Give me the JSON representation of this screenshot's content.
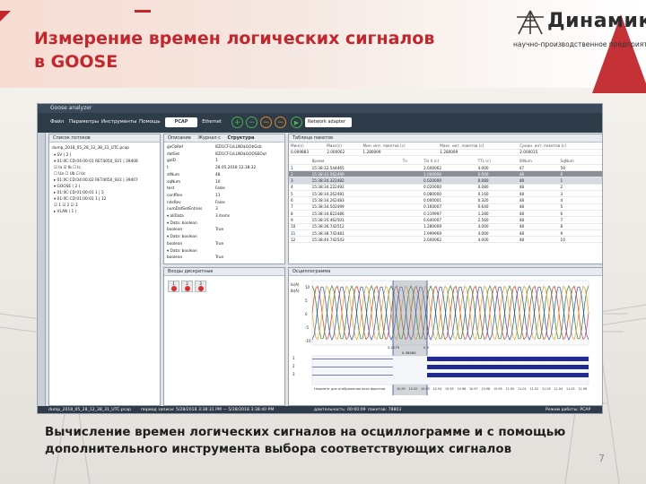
{
  "slide": {
    "title_line1": "Измерение времен логических сигналов",
    "title_line2": "в GOOSE",
    "caption_line1": "Вычисление времен логических сигналов на осциллограмме и с помощью",
    "caption_line2": "дополнительного инструмента выбора соответствующих сигналов",
    "page_number": "7",
    "accent_color": "#c1272d"
  },
  "logo": {
    "name": "Динамика",
    "tagline": "научно-производственное предприятие",
    "icon": "tower-logo-icon"
  },
  "app": {
    "window_title": "Goose analyzer",
    "menu": [
      "Файл",
      "Параметры",
      "Инструменты",
      "Помощь"
    ],
    "toolbar": {
      "pcap_label": "PCAP",
      "ethernet_label": "Ethernet",
      "adapter_label": "Network adapter",
      "icons": [
        "plus-icon",
        "minus-icon",
        "stop-icon",
        "clear-icon",
        "play-icon"
      ]
    },
    "stream_list": {
      "title": "Список потоков",
      "file": "dump_2018_05_28_12_38_31_UTC.pcap",
      "rows": [
        "▾ SV ( 2 )",
        "   ▾ 01:0C:CD:04:00:01   RET4050_SV1  |  39408",
        "      ☑ Ia    ☑ Ib    ☐ Ic",
        "      ☐ Ua    ☐ Ub    ☐ Uc",
        "   ▸ 01:0C:CD:04:00:02   RET4050_SV2  |  39407",
        "▾ GOOSE ( 2 )",
        "   ▸ 01:0C:CD:01:00:01   1  |  5",
        "   ▾ 01:0C:CD:01:00:01   1  |  12",
        "      ☑ 1   ☑ 2   ☑ 3",
        "▸ VLAN ( 1 )"
      ]
    },
    "description": {
      "tabs": [
        "Описание",
        "Журнал с",
        "Структура"
      ],
      "rows": [
        [
          "goCbRef",
          "IED1CFG/LLN0$GO$Gcb"
        ],
        [
          "datSet",
          "IED1CFG/LLN0$GOOSEOut"
        ],
        [
          "goID",
          "1"
        ],
        [
          "t",
          "28.05.2018 12:38:32"
        ],
        [
          "stNum",
          "48"
        ],
        [
          "sqNum",
          "10"
        ],
        [
          "test",
          "False"
        ],
        [
          "confRev",
          "11"
        ],
        [
          "ndsRev",
          "False"
        ],
        [
          "numDatSetEntries",
          "3"
        ],
        [
          "▾ allData",
          "3 items"
        ],
        [
          "   ▾ Data: boolean",
          ""
        ],
        [
          "        boolean",
          "True"
        ],
        [
          "   ▾ Data: boolean",
          ""
        ],
        [
          "        boolean",
          "True"
        ],
        [
          "   ▾ Data: boolean",
          ""
        ],
        [
          "        boolean",
          "True"
        ]
      ]
    },
    "discrete": {
      "title": "Входы дискретные",
      "indicators": [
        "1",
        "2",
        "3"
      ]
    },
    "packet_table": {
      "title": "Таблица пакетов",
      "summary_headers": [
        "Мин(с)",
        "Макс(с)",
        "Мин. инт. пакетов (с)",
        "Макс. инт. пакетов (с)",
        "Средн. инт. пакетов (с)"
      ],
      "summary_values": [
        "0.009883",
        "2.000062",
        "1.280009",
        "1.280009",
        "2.000015"
      ],
      "headers": [
        "",
        "Время",
        "Tn",
        "Tin ñ (c)",
        "TTL (c)",
        "StNum",
        "SqNum"
      ],
      "rows": [
        [
          "1",
          "15:38:32.544465",
          "2.000062",
          "4.000",
          "47",
          "59"
        ],
        [
          "2",
          "15:38:33.562490",
          "1.000000",
          "0.000",
          "48",
          "0"
        ],
        [
          "3",
          "15:38:34.322482",
          "0.020000",
          "0.080",
          "48",
          "1"
        ],
        [
          "4",
          "15:38:34.222492",
          "0.020000",
          "0.080",
          "48",
          "2"
        ],
        [
          "5",
          "15:38:34.262481",
          "0.080000",
          "0.160",
          "48",
          "3"
        ],
        [
          "6",
          "15:38:34.262483",
          "0.000001",
          "0.320",
          "48",
          "4"
        ],
        [
          "7",
          "15:38:34.502499",
          "0.160007",
          "0.640",
          "48",
          "5"
        ],
        [
          "8",
          "15:38:34.822486",
          "0.319997",
          "1.280",
          "48",
          "6"
        ],
        [
          "9",
          "15:38:35.462501",
          "0.640007",
          "2.560",
          "48",
          "7"
        ],
        [
          "10",
          "15:38:36.742512",
          "1.280009",
          "4.000",
          "48",
          "8"
        ],
        [
          "11",
          "15:38:38.742481",
          "1.999969",
          "4.000",
          "48",
          "9"
        ],
        [
          "12",
          "15:38:40.742543",
          "2.000062",
          "4.000",
          "48",
          "10"
        ]
      ]
    },
    "oscillogram": {
      "title": "Осциллограмма",
      "analog_labels": [
        "Ia(А)",
        "Ib(А)"
      ],
      "y_ticks": [
        "10",
        "5",
        "0",
        "-5",
        "-10"
      ],
      "marker1": "0.1075",
      "marker2": "0.0",
      "delta": "0.38065",
      "digital_labels": [
        "1",
        "2",
        "3"
      ],
      "hint": "Нажмите для отображения всех фронтов",
      "x_ticks": [
        "10.99",
        "10.92",
        "10.93",
        "10.94",
        "10.95",
        "10.96",
        "10.97",
        "10.98",
        "10.99",
        "11.00",
        "11.01",
        "11.02",
        "11.03",
        "11.04",
        "11.05",
        "11.06"
      ]
    },
    "status": {
      "file": "dump_2018_05_28_12_38_31_UTC.pcap",
      "period": "период записи: 5/28/2018 3:38:31 PM  —  5/28/2018 3:38:40 PM",
      "duration": "длительность: 00:00:09",
      "packets": "пакетов: 78803",
      "mode": "Режим работы: PCAP"
    }
  }
}
